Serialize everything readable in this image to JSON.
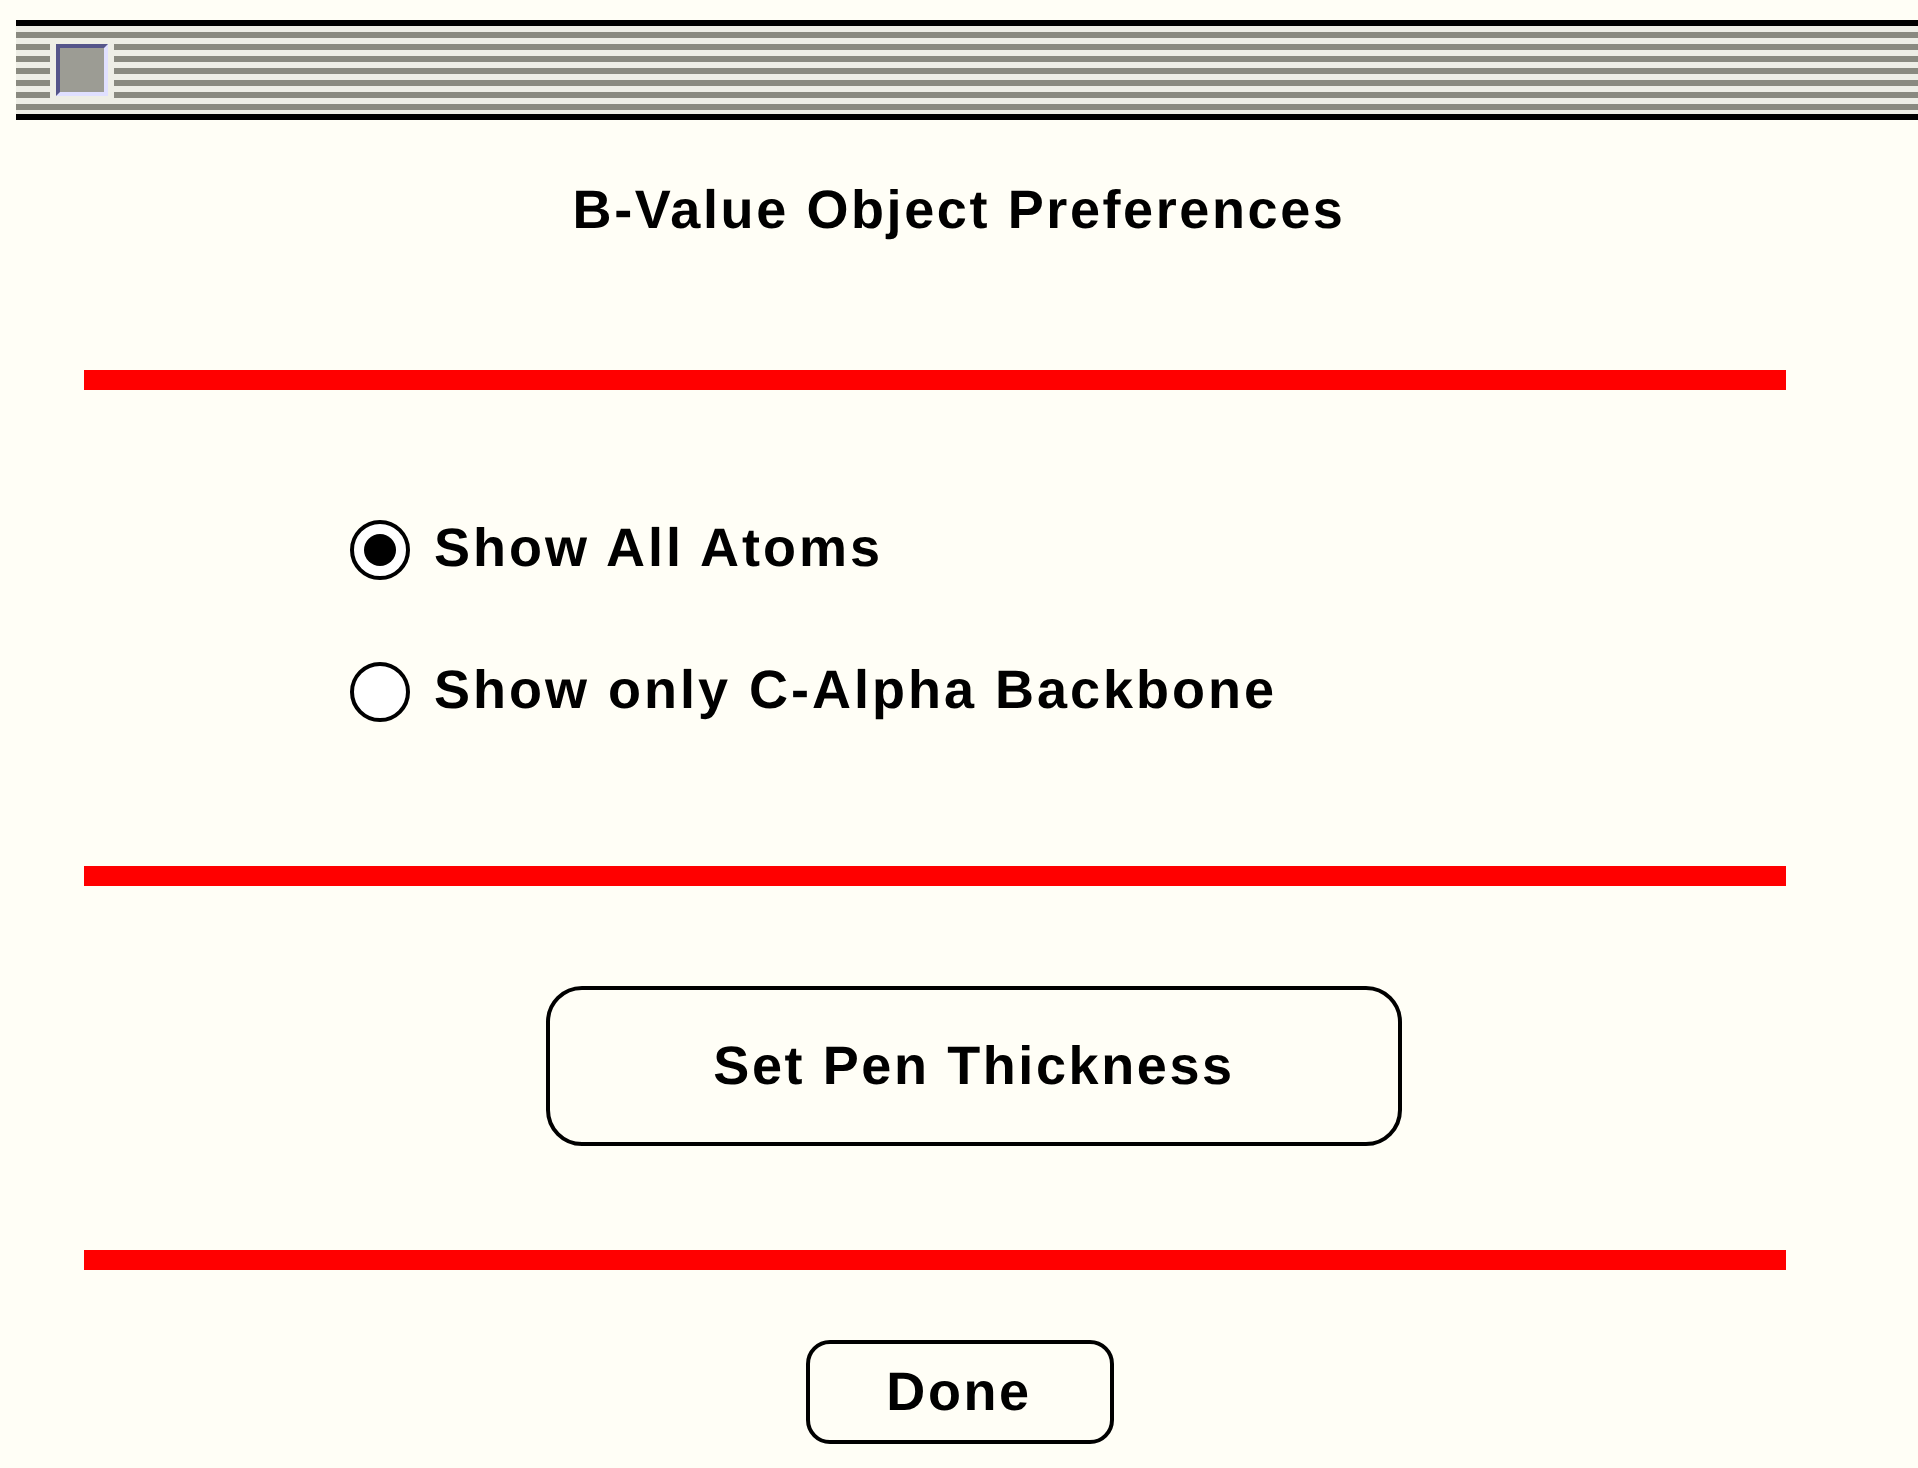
{
  "window": {
    "title": "B-Value Object Preferences"
  },
  "options": [
    {
      "label": "Show All Atoms",
      "selected": true
    },
    {
      "label": "Show only C-Alpha Backbone",
      "selected": false
    }
  ],
  "buttons": [
    {
      "label": "Set Pen Thickness",
      "kind": "large"
    },
    {
      "label": "Done",
      "kind": "small"
    }
  ]
}
